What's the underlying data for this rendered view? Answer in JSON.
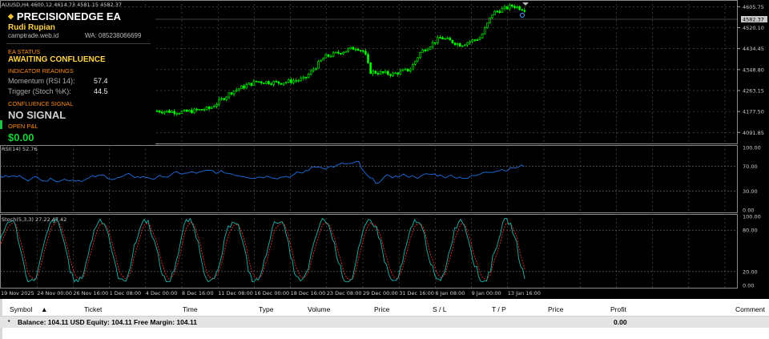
{
  "symbol_header": "AUUSD,H4 4600.12 4614.73 4581.15 4582.37",
  "current_price_label": "4582.37",
  "ea_panel": {
    "title": "PRECISIONEDGE EA",
    "author": "Rudi Rupian",
    "website": "camptrade.web.id",
    "whatsapp": "WA: 085238066699",
    "status_label": "EA STATUS",
    "status_value": "AWAITING CONFLUENCE",
    "indicator_label": "INDICATOR READINGS",
    "indicators": [
      {
        "name": "Momentum (RSI 14):",
        "value": "57.4"
      },
      {
        "name": "Trigger (Stoch %K):",
        "value": "44.5"
      }
    ],
    "signal_label": "CONFLUENCE SIGNAL",
    "signal_value": "NO SIGNAL",
    "pnl_label": "OPEN P&L",
    "pnl_value": "$0.00"
  },
  "price_axis": [
    "4605.75",
    "4520.10",
    "4434.45",
    "4348.80",
    "4263.15",
    "4177.50",
    "4091.85"
  ],
  "rsi_header": "RSI(14) 52.76",
  "rsi_axis": [
    "100.00",
    "70.00",
    "30.00",
    "0.00"
  ],
  "stoch_header": "Stoch(5,3,3) 27.22 47.42",
  "stoch_axis": [
    "100.00",
    "80.00",
    "20.00",
    "0.00"
  ],
  "time_axis": [
    "19 Nov 2025",
    "24 Nov 00:00",
    "26 Nov 16:00",
    "1 Dec 08:00",
    "4 Dec 00:00",
    "8 Dec 16:00",
    "11 Dec 08:00",
    "16 Dec 00:00",
    "18 Dec 16:00",
    "23 Dec 08:00",
    "29 Dec 00:00",
    "31 Dec 16:00",
    "6 Jan 08:00",
    "9 Jan 00:00",
    "13 Jan 16:00"
  ],
  "terminal": {
    "columns": [
      "Symbol",
      "Ticket",
      "Time",
      "Type",
      "Volume",
      "Price",
      "S / L",
      "T / P",
      "Price",
      "Profit",
      "Comment"
    ],
    "sort_indicator": "▲",
    "balance_row": "Balance: 104.11 USD  Equity: 104.11  Free Margin: 104.11",
    "balance_profit": "0.00"
  },
  "colors": {
    "bull_candle": "#00ff00",
    "bear_candle": "#00ff00",
    "rsi_line": "#1e6fe0",
    "stoch_main": "#20b2aa",
    "stoch_signal": "#ff3030",
    "grid": "#5a5a5a",
    "price_tag_bg": "#c8c8c8"
  }
}
